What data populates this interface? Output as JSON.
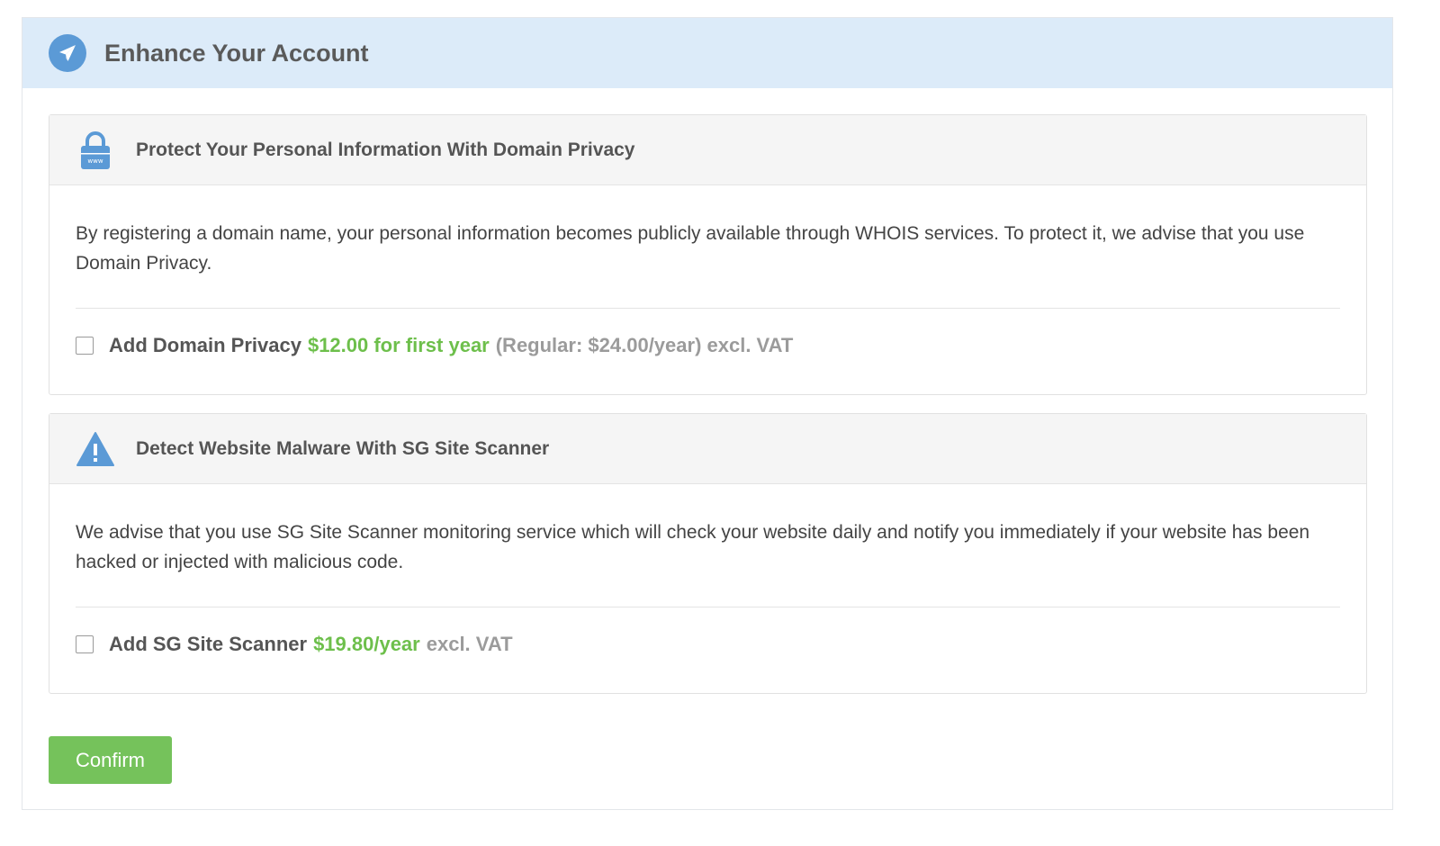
{
  "header": {
    "title": "Enhance Your Account",
    "icon": "paper-plane-icon"
  },
  "sections": [
    {
      "icon": "lock-www-icon",
      "title": "Protect Your Personal Information With Domain Privacy",
      "description": "By registering a domain name, your personal information becomes publicly available through WHOIS services. To protect it, we advise that you use Domain Privacy.",
      "option": {
        "label": "Add Domain Privacy",
        "price": "$12.00 for first year",
        "note": "(Regular: $24.00/year) excl. VAT",
        "checked": false
      }
    },
    {
      "icon": "warning-triangle-icon",
      "title": "Detect Website Malware With SG Site Scanner",
      "description": "We advise that you use SG Site Scanner monitoring service which will check your website daily and notify you immediately if your website has been hacked or injected with malicious code.",
      "option": {
        "label": "Add SG Site Scanner",
        "price": "$19.80/year",
        "note": "excl. VAT",
        "checked": false
      }
    }
  ],
  "confirm_label": "Confirm",
  "colors": {
    "header_bg": "#dcebf9",
    "icon_blue": "#5b9ad6",
    "price_green": "#6dbf4b",
    "button_green": "#75c25b"
  }
}
